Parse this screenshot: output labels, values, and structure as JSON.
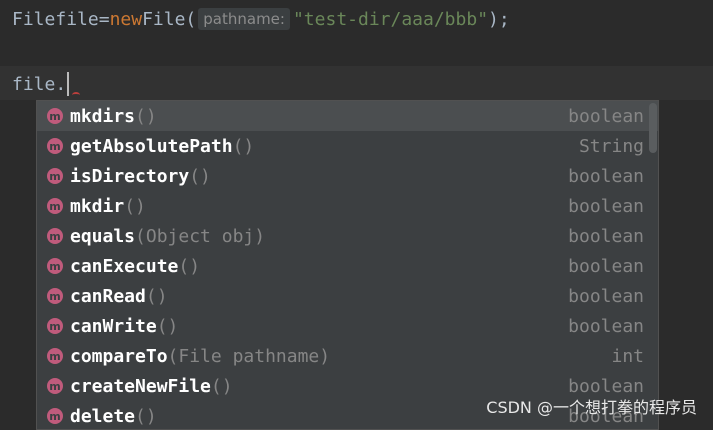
{
  "editor": {
    "line1": {
      "type": "File",
      "var": "file",
      "eq": "=",
      "kw_new": "new",
      "ctor": "File(",
      "param_hint": "pathname:",
      "string_literal": "\"test-dir/aaa/bbb\"",
      "end": ");"
    },
    "line2": {
      "text": "file."
    }
  },
  "completion": {
    "items": [
      {
        "name": "mkdirs",
        "params": "()",
        "return_type": "boolean"
      },
      {
        "name": "getAbsolutePath",
        "params": "()",
        "return_type": "String"
      },
      {
        "name": "isDirectory",
        "params": "()",
        "return_type": "boolean"
      },
      {
        "name": "mkdir",
        "params": "()",
        "return_type": "boolean"
      },
      {
        "name": "equals",
        "params": "(Object obj)",
        "return_type": "boolean"
      },
      {
        "name": "canExecute",
        "params": "()",
        "return_type": "boolean"
      },
      {
        "name": "canRead",
        "params": "()",
        "return_type": "boolean"
      },
      {
        "name": "canWrite",
        "params": "()",
        "return_type": "boolean"
      },
      {
        "name": "compareTo",
        "params": "(File pathname)",
        "return_type": "int"
      },
      {
        "name": "createNewFile",
        "params": "()",
        "return_type": "boolean"
      },
      {
        "name": "delete",
        "params": "()",
        "return_type": "boolean"
      }
    ],
    "method_icon_letter": "m",
    "icon_name": "method-icon",
    "selected_index": 0
  },
  "watermark": "CSDN @一个想打拳的程序员",
  "colors": {
    "background": "#2b2b2b",
    "keyword": "#cc7832",
    "string": "#6a8759",
    "method_icon": "#c05b7c"
  }
}
